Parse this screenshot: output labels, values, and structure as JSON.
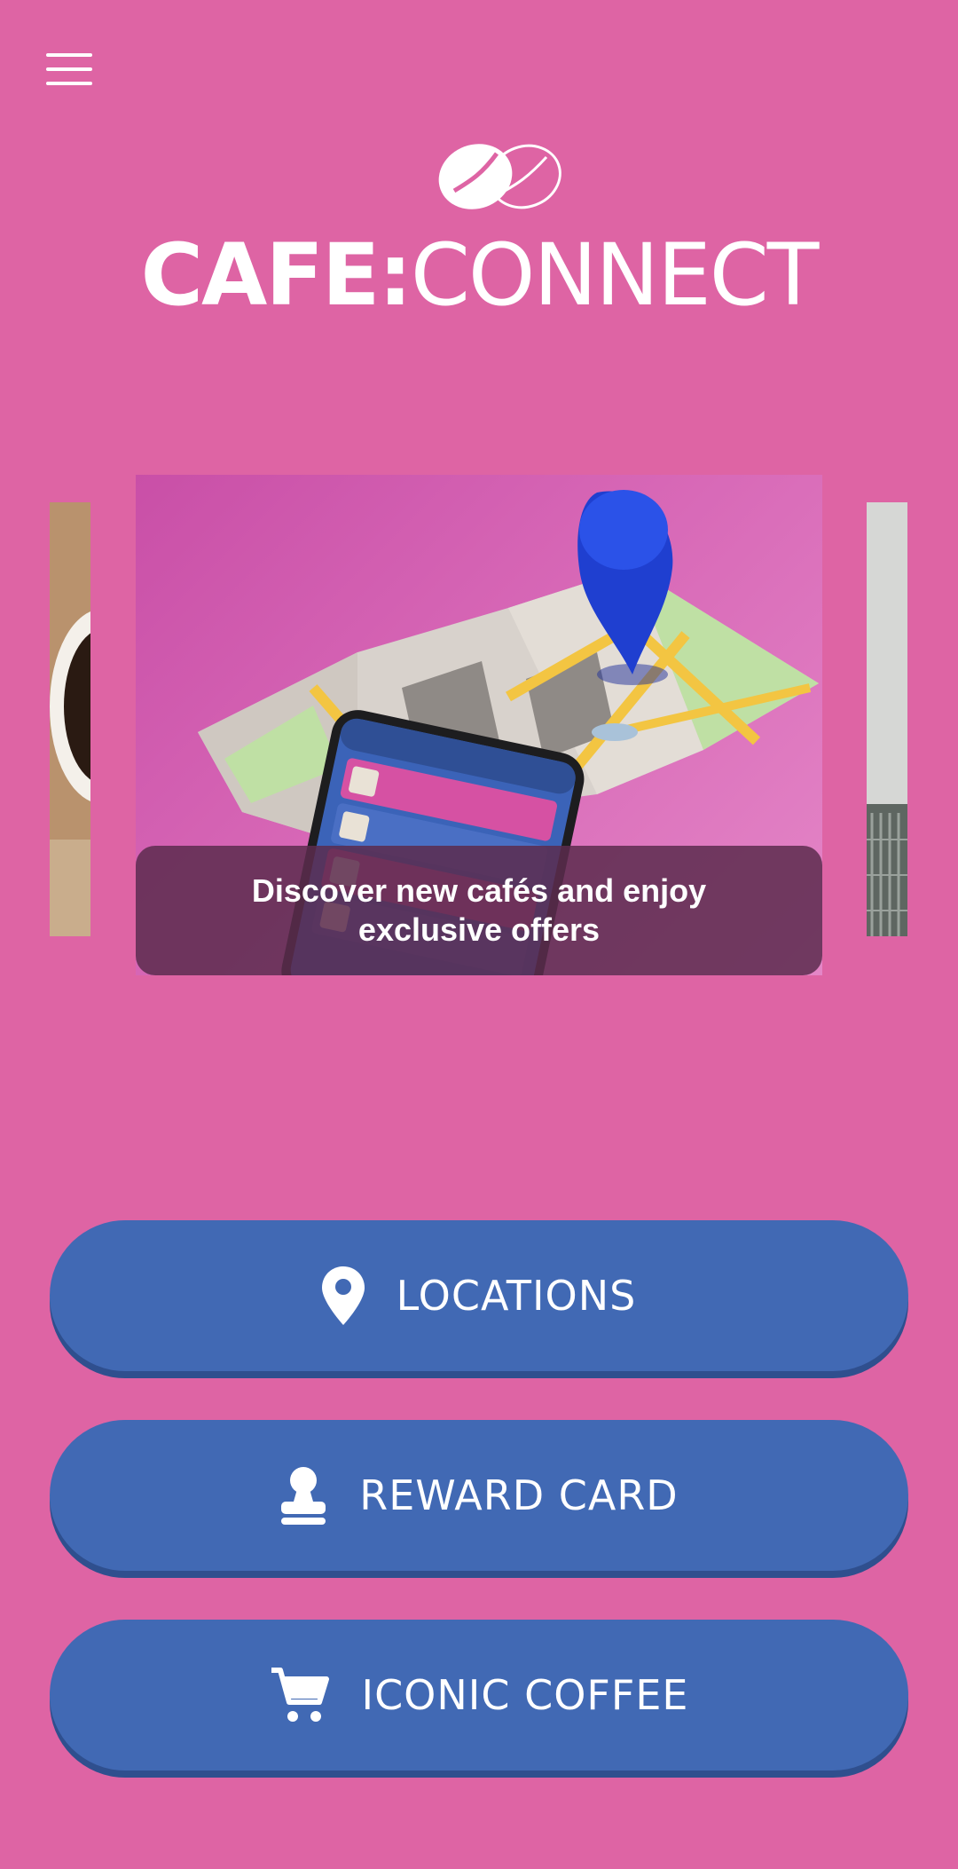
{
  "header": {
    "menu_icon": "hamburger-menu-icon",
    "logo_bold": "CAFE:",
    "logo_thin": "CONNECT"
  },
  "carousel": {
    "active_caption": "Discover new cafés and enjoy exclusive offers"
  },
  "buttons": [
    {
      "label": "LOCATIONS",
      "icon": "map-pin-icon"
    },
    {
      "label": "REWARD CARD",
      "icon": "stamp-icon"
    },
    {
      "label": "ICONIC COFFEE",
      "icon": "shopping-cart-icon"
    }
  ],
  "colors": {
    "background": "#de64a4",
    "button": "#4169b4",
    "button_shadow": "#2f4f8e",
    "caption_overlay": "#5c2c4e"
  }
}
